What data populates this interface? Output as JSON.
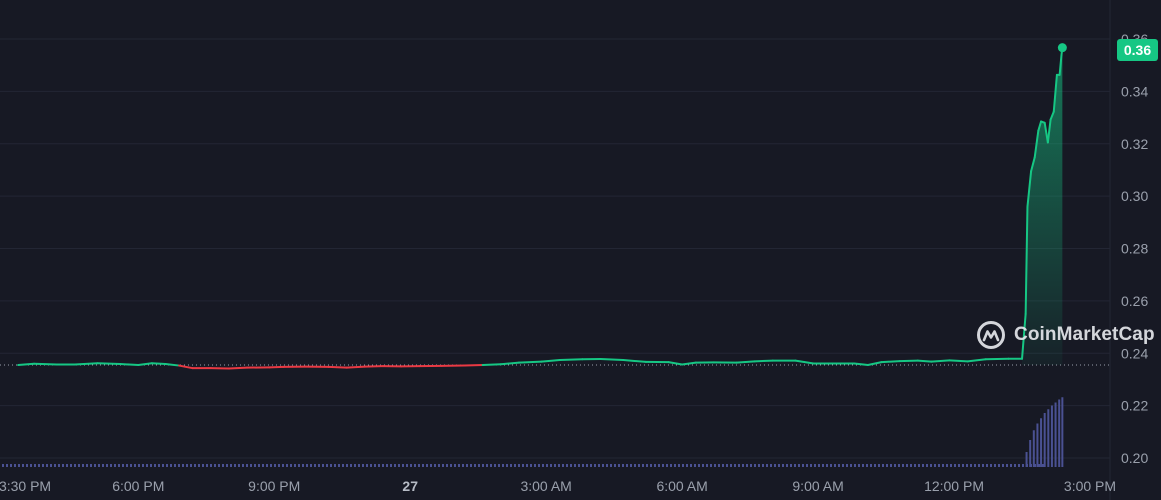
{
  "chart_data": {
    "type": "line",
    "brand": "CoinMarketCap",
    "current_price_label": "0.36",
    "colors": {
      "background": "#171924",
      "up": "#16c784",
      "down": "#ea3943",
      "grid": "#232634",
      "baseline": "#9aa0ac",
      "volume": "#4a5192",
      "axis_text": "#9aa0ac"
    },
    "y_axis": {
      "position": "right",
      "range": [
        0.195,
        0.37
      ],
      "ticks": [
        "0.20",
        "0.22",
        "0.24",
        "0.26",
        "0.28",
        "0.30",
        "0.32",
        "0.34",
        "0.36"
      ]
    },
    "x_axis": {
      "range_hours": [
        13.1,
        38.55
      ],
      "ticks": [
        {
          "label": "3:30 PM",
          "hour": 15.5,
          "bold": false
        },
        {
          "label": "6:00 PM",
          "hour": 18,
          "bold": false
        },
        {
          "label": "9:00 PM",
          "hour": 21,
          "bold": false
        },
        {
          "label": "27",
          "hour": 24,
          "bold": true
        },
        {
          "label": "3:00 AM",
          "hour": 27,
          "bold": false
        },
        {
          "label": "6:00 AM",
          "hour": 30,
          "bold": false
        },
        {
          "label": "9:00 AM",
          "hour": 33,
          "bold": false
        },
        {
          "label": "12:00 PM",
          "hour": 36,
          "bold": false
        },
        {
          "label": "3:00 PM",
          "hour": 39,
          "bold": false
        }
      ]
    },
    "baseline_price": 0.2355,
    "series": [
      {
        "points": [
          [
            15.35,
            0.2355
          ],
          [
            15.7,
            0.236
          ],
          [
            16.2,
            0.2357
          ],
          [
            16.6,
            0.2357
          ],
          [
            17.1,
            0.2362
          ],
          [
            17.6,
            0.2359
          ],
          [
            18.0,
            0.2355
          ],
          [
            18.3,
            0.2362
          ],
          [
            18.6,
            0.2359
          ],
          [
            18.9,
            0.2353
          ],
          [
            19.2,
            0.2343
          ],
          [
            19.6,
            0.2343
          ],
          [
            20.0,
            0.2342
          ],
          [
            20.4,
            0.2345
          ],
          [
            20.9,
            0.2346
          ],
          [
            21.2,
            0.2348
          ],
          [
            21.7,
            0.2349
          ],
          [
            22.2,
            0.2348
          ],
          [
            22.6,
            0.2345
          ],
          [
            23.0,
            0.2349
          ],
          [
            23.4,
            0.2351
          ],
          [
            23.8,
            0.235
          ],
          [
            24.2,
            0.2351
          ],
          [
            24.7,
            0.2352
          ],
          [
            25.2,
            0.2353
          ],
          [
            25.6,
            0.2355
          ],
          [
            26.0,
            0.2358
          ],
          [
            26.4,
            0.2364
          ],
          [
            26.9,
            0.2368
          ],
          [
            27.3,
            0.2374
          ],
          [
            27.8,
            0.2377
          ],
          [
            28.2,
            0.2378
          ],
          [
            28.7,
            0.2374
          ],
          [
            29.2,
            0.2367
          ],
          [
            29.7,
            0.2366
          ],
          [
            30.0,
            0.2357
          ],
          [
            30.3,
            0.2364
          ],
          [
            30.7,
            0.2365
          ],
          [
            31.2,
            0.2364
          ],
          [
            31.6,
            0.2369
          ],
          [
            32.0,
            0.2372
          ],
          [
            32.5,
            0.2372
          ],
          [
            32.9,
            0.2361
          ],
          [
            33.3,
            0.2361
          ],
          [
            33.8,
            0.2361
          ],
          [
            34.1,
            0.2355
          ],
          [
            34.4,
            0.2366
          ],
          [
            34.8,
            0.237
          ],
          [
            35.2,
            0.2372
          ],
          [
            35.5,
            0.2368
          ],
          [
            35.9,
            0.2373
          ],
          [
            36.3,
            0.2369
          ],
          [
            36.7,
            0.2377
          ],
          [
            37.2,
            0.2379
          ],
          [
            37.5,
            0.2379
          ],
          [
            37.58,
            0.255
          ],
          [
            37.62,
            0.296
          ],
          [
            37.7,
            0.3095
          ],
          [
            37.78,
            0.3148
          ],
          [
            37.86,
            0.325
          ],
          [
            37.92,
            0.3285
          ],
          [
            38.0,
            0.328
          ],
          [
            38.07,
            0.3205
          ],
          [
            38.13,
            0.3292
          ],
          [
            38.2,
            0.3322
          ],
          [
            38.27,
            0.3463
          ],
          [
            38.33,
            0.3463
          ],
          [
            38.37,
            0.3538
          ],
          [
            38.39,
            0.3567
          ]
        ]
      }
    ],
    "volume": {
      "spike_hours": [
        37.6,
        37.68,
        37.76,
        37.84,
        37.92,
        38.0,
        38.08,
        38.16,
        38.24,
        38.32,
        38.39
      ],
      "spike_relative": [
        0.2,
        0.36,
        0.49,
        0.58,
        0.65,
        0.72,
        0.77,
        0.82,
        0.86,
        0.9,
        0.93
      ]
    }
  }
}
